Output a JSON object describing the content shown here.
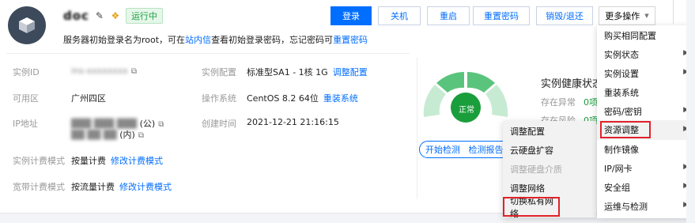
{
  "header": {
    "instance_name": "doc",
    "status": "运行中",
    "subtitle_pre": "服务器初始登录名为root，可在",
    "subtitle_link1": "站内信",
    "subtitle_mid": "查看初始登录密码，忘记密码可",
    "subtitle_link2": "重置密码"
  },
  "toolbar": {
    "login": "登录",
    "shutdown": "关机",
    "restart": "重启",
    "reset_password": "重置密码",
    "destroy": "销毁/退还",
    "more": "更多操作",
    "more_arrow": "▼"
  },
  "info": {
    "instance_id_label": "实例ID",
    "instance_id_value": "ins-xxxxxxxx",
    "zone_label": "可用区",
    "zone_value": "广州四区",
    "ip_label": "IP地址",
    "ip_public": "(公)",
    "ip_private": "(内)",
    "billing_label": "实例计费模式",
    "billing_value": "按量计费",
    "billing_link": "修改计费模式",
    "bandwidth_label": "宽带计费模式",
    "bandwidth_value": "按流量计费",
    "bandwidth_link": "修改计费模式",
    "config_label": "实例配置",
    "config_value": "标准型SA1 - 1核 1G",
    "config_link": "调整配置",
    "os_label": "操作系统",
    "os_value": "CentOS 8.2 64位",
    "os_link": "重装系统",
    "created_label": "创建时间",
    "created_value": "2021-12-21 21:16:15"
  },
  "health": {
    "title": "实例健康状态",
    "gauge_label": "正常",
    "abnormal_label": "存在异常",
    "abnormal_value": "0项",
    "risk_label": "存在风险",
    "risk_value": "0项",
    "start_check": "开始检测",
    "report": "检测报告"
  },
  "more_menu": [
    {
      "label": "购买相同配置",
      "arrow": ""
    },
    {
      "label": "实例状态",
      "arrow": "▶"
    },
    {
      "label": "实例设置",
      "arrow": "▶"
    },
    {
      "label": "重装系统",
      "arrow": ""
    },
    {
      "label": "密码/密钥",
      "arrow": "▶"
    },
    {
      "label": "资源调整",
      "arrow": "▶"
    },
    {
      "label": "制作镜像",
      "arrow": ""
    },
    {
      "label": "IP/网卡",
      "arrow": "▶"
    },
    {
      "label": "安全组",
      "arrow": "▶"
    },
    {
      "label": "运维与检测",
      "arrow": "▶"
    }
  ],
  "resource_submenu": [
    {
      "label": "调整配置"
    },
    {
      "label": "云硬盘扩容"
    },
    {
      "label": "调整硬盘介质"
    },
    {
      "label": "调整网络"
    },
    {
      "label": "切换私有网络"
    }
  ],
  "colors": {
    "accent": "#006eff",
    "success": "#1a9e3c",
    "highlight": "#e0222a"
  }
}
